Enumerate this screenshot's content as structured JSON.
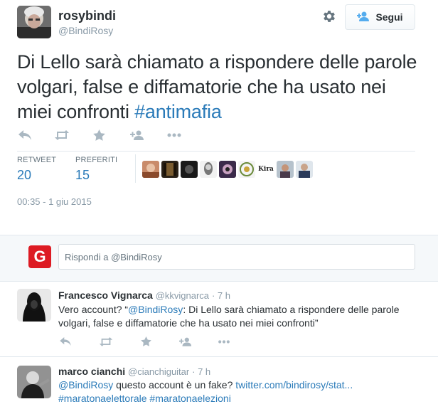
{
  "tweet": {
    "author_name": "rosybindi",
    "author_handle": "@BindiRosy",
    "follow_label": "Segui",
    "text_before": "Di Lello sarà chiamato a rispondere delle parole volgari, false e diffamatorie che ha usato nei miei confronti ",
    "hashtag": "#antimafia",
    "stats": {
      "retweet_label": "RETWEET",
      "retweet_count": "20",
      "favorites_label": "PREFERITI",
      "favorites_count": "15"
    },
    "timestamp": "00:35 - 1 giu 2015",
    "favoriters": [
      "favoriter-1",
      "favoriter-2",
      "favoriter-3",
      "favoriter-4",
      "favoriter-5",
      "favoriter-6",
      "favoriter-7",
      "favoriter-8",
      "favoriter-9"
    ],
    "kira_text": "Kira"
  },
  "reply_box": {
    "avatar_letter": "G",
    "placeholder": "Rispondi a",
    "mention": "@BindiRosy"
  },
  "replies": [
    {
      "name": "Francesco Vignarca",
      "handle": "@kkvignarca",
      "time": "· 7 h",
      "text_prefix": "Vero account? “",
      "mention": "@BindiRosy",
      "text_body": ": Di Lello sarà chiamato a rispondere delle parole volgari, false e diffamatorie che ha usato nei miei confronti”"
    },
    {
      "name": "marco cianchi",
      "handle": "@cianchiguitar",
      "time": "· 7 h",
      "mention": "@BindiRosy",
      "text_body": " questo account è un fake? ",
      "link": "twitter.com/bindirosy/stat...",
      "hashtag1": "#maratonaelettorale",
      "hashtag2": "#maratonaelezioni"
    }
  ],
  "colors": {
    "link": "#2b7bb9",
    "muted": "#8899a6",
    "text": "#292f33",
    "icon": "#aab8c2",
    "reply_avatar_red": "#dd1b23"
  },
  "icons": [
    "reply-icon",
    "retweet-icon",
    "favorite-icon",
    "follow-icon",
    "more-icon",
    "gear-icon",
    "add-user-icon"
  ]
}
